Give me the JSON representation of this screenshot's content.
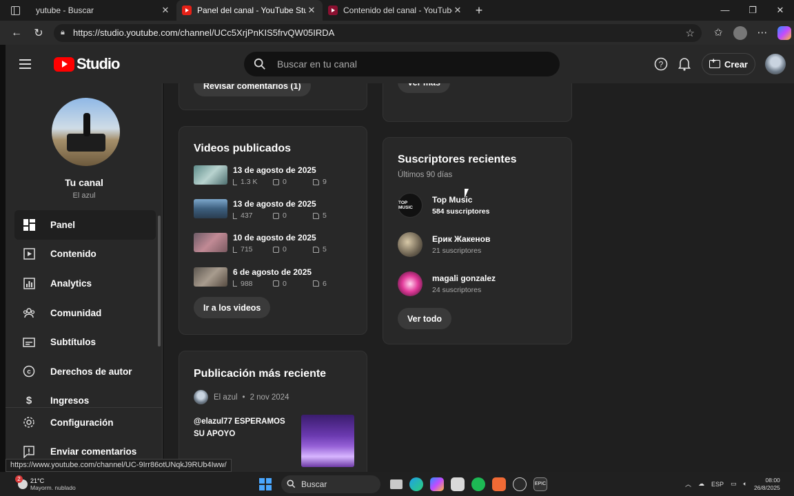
{
  "browser": {
    "tabs": [
      {
        "title": "yutube - Buscar",
        "favicon": "search-icon",
        "active": false
      },
      {
        "title": "Panel del canal - YouTube Studio",
        "favicon": "youtube-icon",
        "active": true
      },
      {
        "title": "Contenido del canal - YouTube St",
        "favicon": "youtube-icon",
        "active": false
      }
    ],
    "url": "https://studio.youtube.com/channel/UCc5XrjPnKIS5frvQW05IRDA",
    "status_url": "https://www.youtube.com/channel/UC-9Irr86otUNqkJ9RUb4Iww/"
  },
  "header": {
    "logo_text": "Studio",
    "search_placeholder": "Buscar en tu canal",
    "create_label": "Crear"
  },
  "sidebar": {
    "channel_title": "Tu canal",
    "channel_name": "El azul",
    "items": [
      {
        "label": "Panel",
        "icon": "dashboard-icon",
        "active": true
      },
      {
        "label": "Contenido",
        "icon": "content-icon"
      },
      {
        "label": "Analytics",
        "icon": "analytics-icon"
      },
      {
        "label": "Comunidad",
        "icon": "community-icon"
      },
      {
        "label": "Subtítulos",
        "icon": "subtitles-icon"
      },
      {
        "label": "Derechos de autor",
        "icon": "copyright-icon"
      },
      {
        "label": "Ingresos",
        "icon": "earn-icon"
      }
    ],
    "bottom_items": [
      {
        "label": "Configuración",
        "icon": "gear-icon"
      },
      {
        "label": "Enviar comentarios",
        "icon": "feedback-icon"
      }
    ]
  },
  "comments_card": {
    "button": "Revisar comentarios (1)"
  },
  "top_right_card": {
    "button": "Ver más"
  },
  "videos_card": {
    "title": "Videos publicados",
    "videos": [
      {
        "date": "13 de agosto de 2025",
        "views": "1.3 K",
        "comments": "0",
        "likes": "9",
        "thumb_color": "#6fa6a8"
      },
      {
        "date": "13 de agosto de 2025",
        "views": "437",
        "comments": "0",
        "likes": "5",
        "thumb_color": "#4f7fa6"
      },
      {
        "date": "10 de agosto de 2025",
        "views": "715",
        "comments": "0",
        "likes": "5",
        "thumb_color": "#9b6a74"
      },
      {
        "date": "6 de agosto de 2025",
        "views": "988",
        "comments": "0",
        "likes": "6",
        "thumb_color": "#7a7064"
      }
    ],
    "button": "Ir a los videos"
  },
  "subscribers_card": {
    "title": "Suscriptores recientes",
    "subtitle": "Últimos 90 días",
    "subscribers": [
      {
        "name": "Top Music",
        "count": "584 suscriptores",
        "avatar_text": "TOP MUSIC",
        "highlight": true
      },
      {
        "name": "Ерик Жакенов",
        "count": "21 suscriptores"
      },
      {
        "name": "magali gonzalez",
        "count": "24 suscriptores"
      }
    ],
    "button": "Ver todo"
  },
  "latest_post": {
    "title": "Publicación más reciente",
    "author": "El azul",
    "date": "2 nov 2024",
    "text": "@elazul77 ESPERAMOS SU APOYO"
  },
  "taskbar": {
    "weather_temp": "21°C",
    "weather_desc": "Mayorm. nublado",
    "weather_badge": "2",
    "search": "Buscar",
    "lang": "ESP",
    "time": "08:00",
    "date": "26/8/2025"
  }
}
